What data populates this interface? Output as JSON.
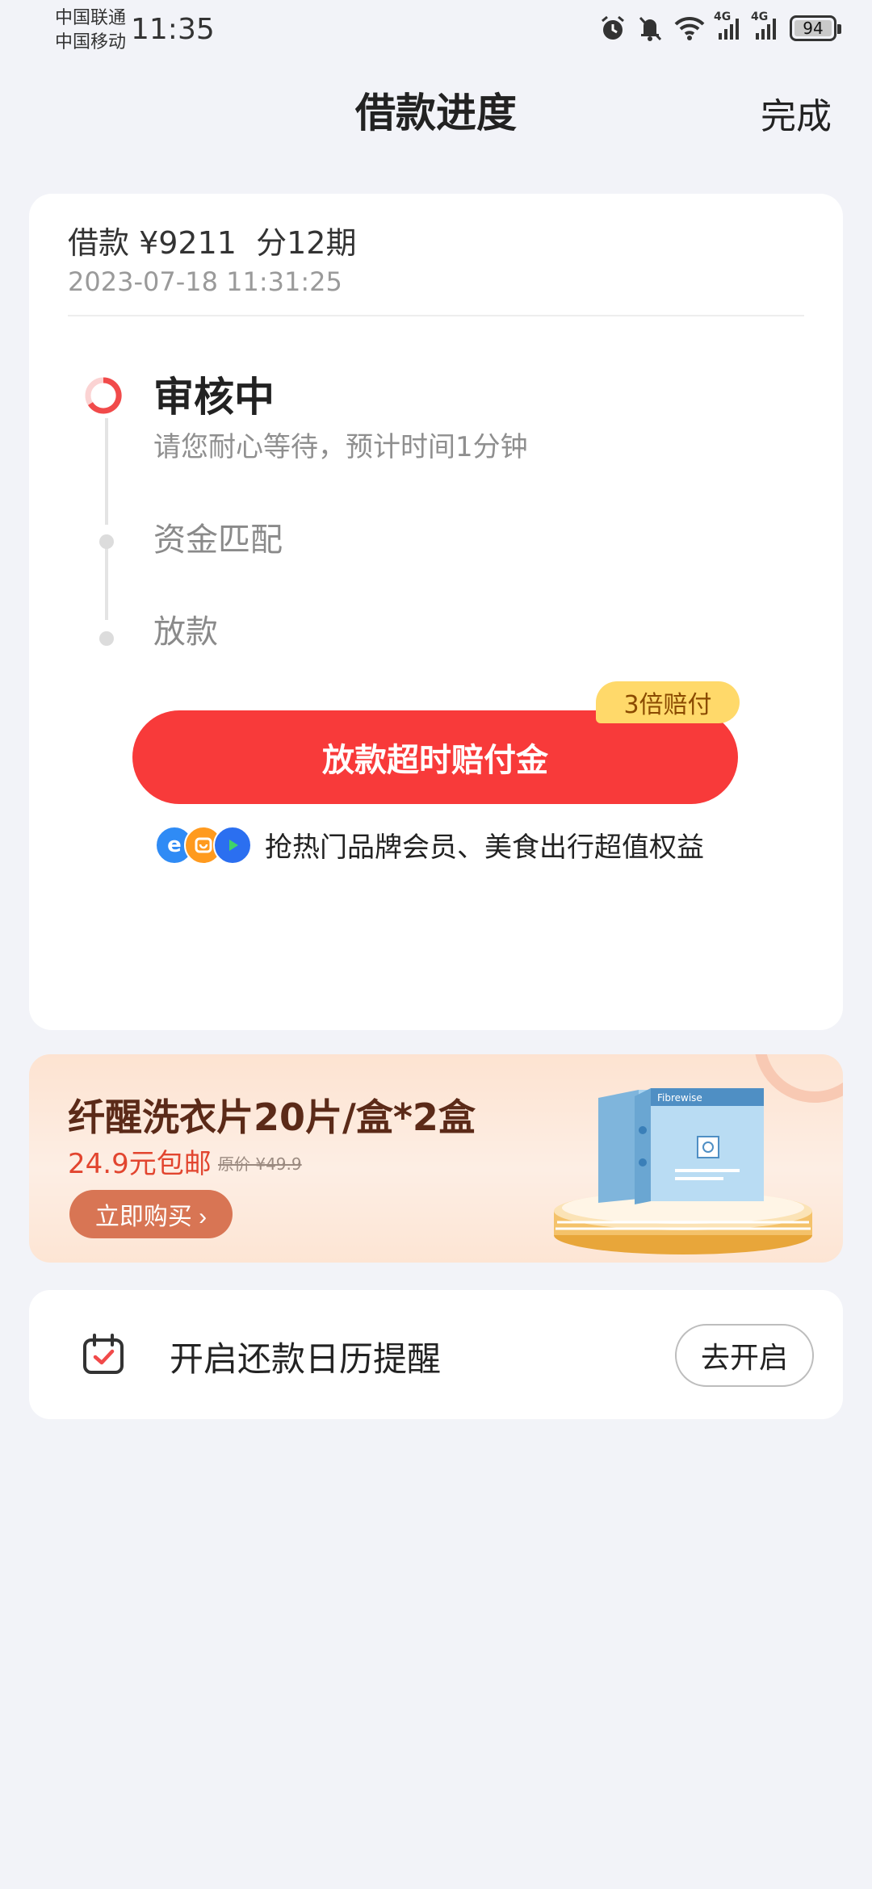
{
  "status_bar": {
    "carrier_1": "中国联通",
    "carrier_2": "中国移动",
    "time": "11:35",
    "network_1": "4G",
    "network_2": "4G",
    "battery": "94",
    "icons": [
      "alarm-icon",
      "mute-icon",
      "wifi-icon",
      "signal-icon",
      "signal-icon",
      "battery-icon"
    ]
  },
  "nav": {
    "title": "借款进度",
    "done_label": "完成"
  },
  "loan": {
    "summary": "借款 ¥9211  分12期",
    "timestamp": "2023-07-18 11:31:25"
  },
  "progress": {
    "active_step": {
      "title": "审核中",
      "subtitle": "请您耐心等待，预计时间1分钟"
    },
    "steps": [
      {
        "label": "资金匹配"
      },
      {
        "label": "放款"
      }
    ]
  },
  "compensation": {
    "button_label": "放款超时赔付金",
    "badge": "3倍赔付"
  },
  "perks": {
    "text": "抢热门品牌会员、美食出行超值权益",
    "icons": [
      "e-app-icon",
      "smile-app-icon",
      "play-app-icon"
    ]
  },
  "promo": {
    "title": "纤醒洗衣片20片/盒*2盒",
    "price": "24.9元包邮",
    "original_price": "原价 ¥49.9",
    "button_label": "立即购买 ›",
    "product_brand": "Fibrewise"
  },
  "reminder": {
    "text": "开启还款日历提醒",
    "button_label": "去开启"
  },
  "colors": {
    "accent_red": "#f83a3a",
    "badge_yellow": "#ffd96a",
    "page_bg": "#f2f3f8",
    "promo_button": "#d87554"
  }
}
